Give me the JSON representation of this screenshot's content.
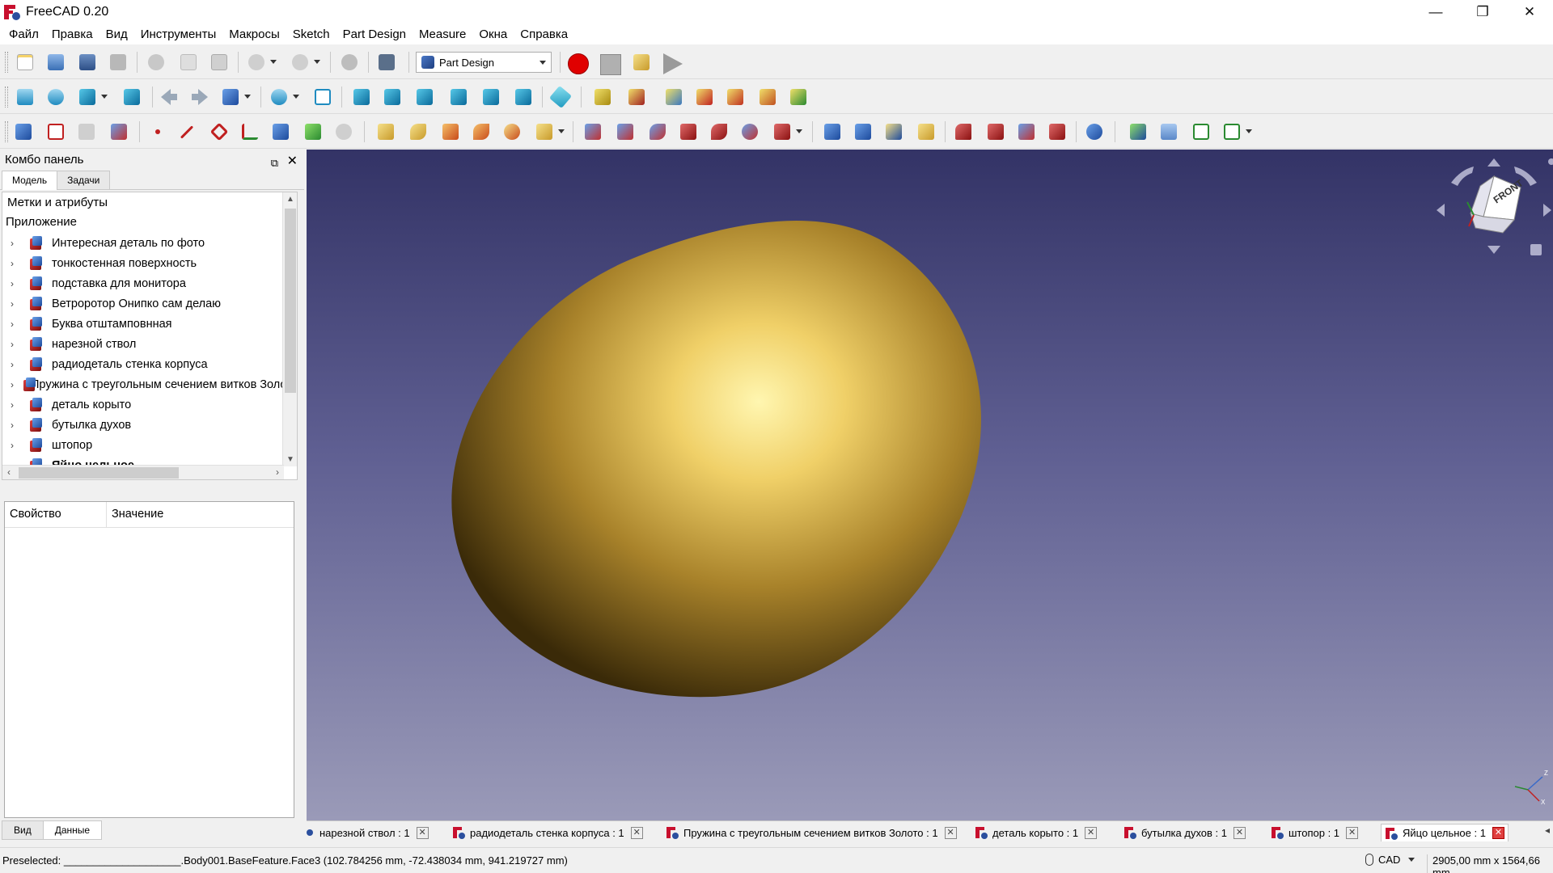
{
  "window": {
    "title": "FreeCAD 0.20",
    "controls": [
      "—",
      "❐",
      "✕"
    ]
  },
  "menu": [
    "Файл",
    "Правка",
    "Вид",
    "Инструменты",
    "Макросы",
    "Sketch",
    "Part Design",
    "Measure",
    "Окна",
    "Справка"
  ],
  "toolbar": {
    "workbench": "Part Design"
  },
  "combo": {
    "title": "Комбо панель",
    "tabs": [
      "Модель",
      "Задачи"
    ],
    "tree_header": "Метки и атрибуты",
    "app_label": "Приложение",
    "items": [
      "Интересная деталь по фото",
      "тонкостенная поверхность",
      "подставка для монитора",
      "Ветроротор Онипко сам делаю",
      "Буква отштамповнная",
      "нарезной ствол",
      "радиодеталь стенка корпуса",
      "Пружина с треугольным сечением витков Золото",
      "деталь корыто",
      "бутылка духов",
      "штопор",
      "Яйцо цельное"
    ],
    "props_columns": [
      "Свойство",
      "Значение"
    ],
    "bottom_tabs": [
      "Вид",
      "Данные"
    ]
  },
  "view": {
    "egg_color": "#c9a63a",
    "bg_top": "#333366",
    "bg_bottom": "#9a9ab8",
    "navcube_face": "FRONT"
  },
  "doc_tabs": [
    "нарезной ствол : 1",
    "радиодеталь стенка корпуса : 1",
    "Пружина с треугольным сечением витков Золото : 1",
    "деталь корыто : 1",
    "бутылка духов : 1",
    "штопор : 1",
    "Яйцо цельное : 1"
  ],
  "status": {
    "preselected": "Preselected: ____________________.Body001.BaseFeature.Face3 (102.784256 mm, -72.438034 mm, 941.219727 mm)",
    "nav_style": "CAD",
    "dimensions": "2905,00 mm x 1564,66 mm"
  }
}
